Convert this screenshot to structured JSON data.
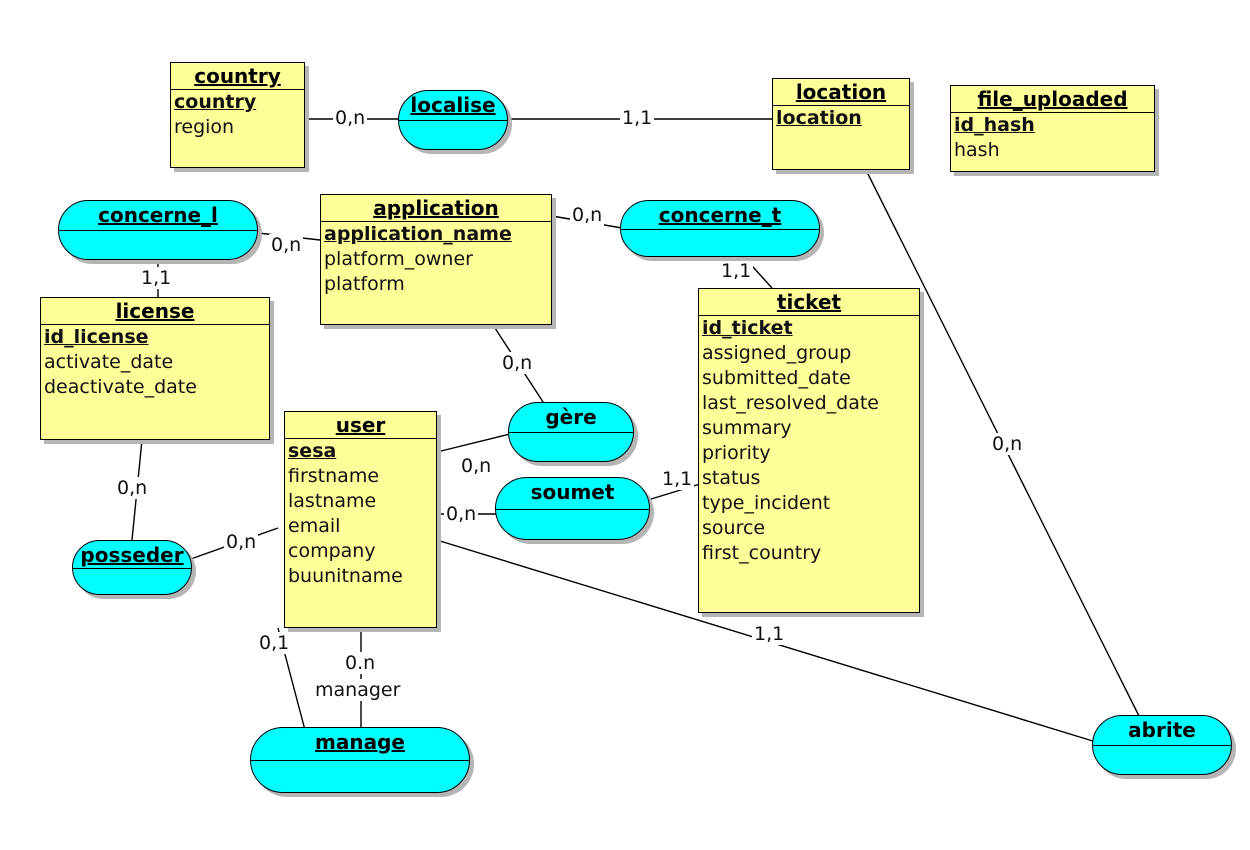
{
  "diagram": {
    "type": "entity-relationship-diagram",
    "title": "ER Diagram",
    "colors": {
      "entity_fill": "#ffff99",
      "relationship_fill": "#00ffff",
      "border": "#000000",
      "shadow": "#b5b5b5",
      "background": "#ffffff"
    }
  },
  "entities": [
    {
      "id": "country",
      "name": "country",
      "attributes": [
        {
          "name": "country",
          "key": true
        },
        {
          "name": "region",
          "key": false
        }
      ]
    },
    {
      "id": "location",
      "name": "location",
      "attributes": [
        {
          "name": "location",
          "key": true
        }
      ]
    },
    {
      "id": "file_uploaded",
      "name": "file_uploaded",
      "attributes": [
        {
          "name": "id_hash",
          "key": true
        },
        {
          "name": "hash",
          "key": false
        }
      ]
    },
    {
      "id": "application",
      "name": "application",
      "attributes": [
        {
          "name": "application_name",
          "key": true
        },
        {
          "name": "platform_owner",
          "key": false
        },
        {
          "name": "platform",
          "key": false
        }
      ]
    },
    {
      "id": "license",
      "name": "license",
      "attributes": [
        {
          "name": "id_license",
          "key": true
        },
        {
          "name": "activate_date",
          "key": false
        },
        {
          "name": "deactivate_date",
          "key": false
        }
      ]
    },
    {
      "id": "ticket",
      "name": "ticket",
      "attributes": [
        {
          "name": "id_ticket",
          "key": true
        },
        {
          "name": "assigned_group",
          "key": false
        },
        {
          "name": "submitted_date",
          "key": false
        },
        {
          "name": "last_resolved_date",
          "key": false
        },
        {
          "name": "summary",
          "key": false
        },
        {
          "name": "priority",
          "key": false
        },
        {
          "name": "status",
          "key": false
        },
        {
          "name": "type_incident",
          "key": false
        },
        {
          "name": "source",
          "key": false
        },
        {
          "name": "first_country",
          "key": false
        }
      ]
    },
    {
      "id": "user",
      "name": "user",
      "attributes": [
        {
          "name": "sesa",
          "key": true
        },
        {
          "name": "firstname",
          "key": false
        },
        {
          "name": "lastname",
          "key": false
        },
        {
          "name": "email",
          "key": false
        },
        {
          "name": "company",
          "key": false
        },
        {
          "name": "buunitname",
          "key": false
        }
      ]
    }
  ],
  "relationships": [
    {
      "id": "localise",
      "name": "localise"
    },
    {
      "id": "concerne_l",
      "name": "concerne_l"
    },
    {
      "id": "concerne_t",
      "name": "concerne_t"
    },
    {
      "id": "gere",
      "name": "gère"
    },
    {
      "id": "soumet",
      "name": "soumet"
    },
    {
      "id": "posseder",
      "name": "posseder"
    },
    {
      "id": "manage",
      "name": "manage"
    },
    {
      "id": "abrite",
      "name": "abrite"
    }
  ],
  "cardinalities": [
    {
      "id": "c1",
      "label": "0,n",
      "between": "country - localise"
    },
    {
      "id": "c2",
      "label": "1,1",
      "between": "localise - location"
    },
    {
      "id": "c3",
      "label": "0,n",
      "between": "concerne_l - application"
    },
    {
      "id": "c4",
      "label": "1,1",
      "between": "concerne_l - license"
    },
    {
      "id": "c5",
      "label": "0,n",
      "between": "application - concerne_t"
    },
    {
      "id": "c6",
      "label": "1,1",
      "between": "concerne_t - ticket"
    },
    {
      "id": "c7",
      "label": "0,n",
      "between": "application - gère"
    },
    {
      "id": "c8",
      "label": "0,n",
      "between": "user - gère"
    },
    {
      "id": "c9",
      "label": "0,n",
      "between": "user - soumet"
    },
    {
      "id": "c10",
      "label": "1,1",
      "between": "soumet - ticket"
    },
    {
      "id": "c11",
      "label": "0,n",
      "between": "license - posseder"
    },
    {
      "id": "c12",
      "label": "0,n",
      "between": "posseder - user"
    },
    {
      "id": "c13",
      "label": "0,1",
      "between": "user - manage"
    },
    {
      "id": "c14",
      "label": "0.n",
      "between": "user - manage"
    },
    {
      "id": "c15",
      "label": "0,n",
      "between": "location - abrite"
    },
    {
      "id": "c16",
      "label": "1,1",
      "between": "user - abrite"
    }
  ],
  "roles": [
    {
      "id": "r1",
      "label": "manager",
      "on": "user - manage"
    }
  ]
}
